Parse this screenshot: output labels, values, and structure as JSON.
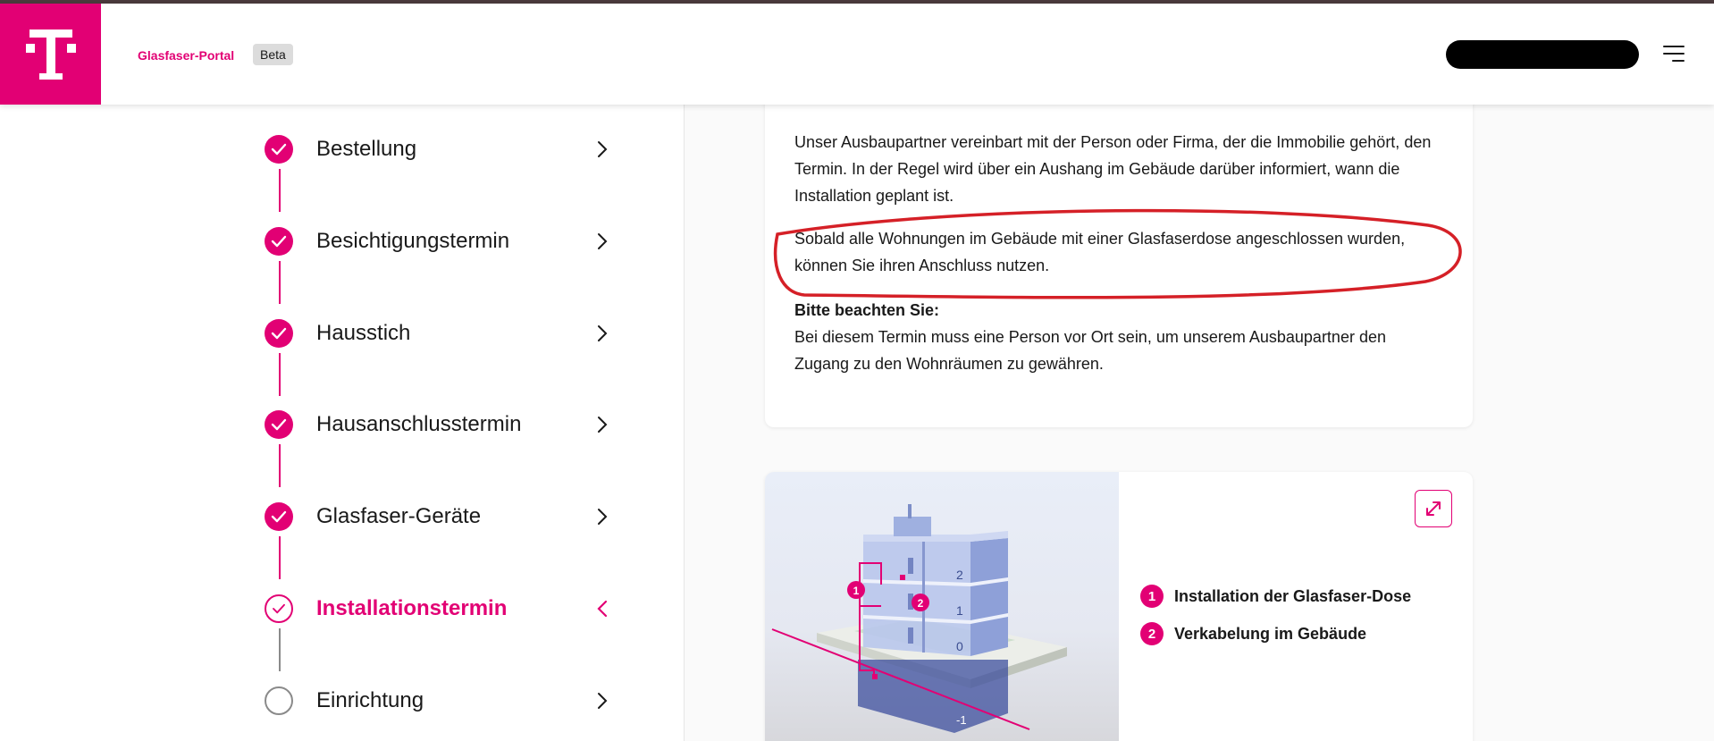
{
  "header": {
    "brand": "Glasfaser-Portal",
    "badge": "Beta",
    "logo_letter": "T",
    "accent": "#e20074",
    "menu_icon": "hamburger-menu-icon"
  },
  "steps": [
    {
      "label": "Bestellung",
      "status": "done"
    },
    {
      "label": "Besichtigungstermin",
      "status": "done"
    },
    {
      "label": "Hausstich",
      "status": "done"
    },
    {
      "label": "Hausanschlusstermin",
      "status": "done"
    },
    {
      "label": "Glasfaser-Geräte",
      "status": "done"
    },
    {
      "label": "Installationstermin",
      "status": "active"
    },
    {
      "label": "Einrichtung",
      "status": "todo"
    }
  ],
  "content": {
    "paragraph1": "Unser Ausbaupartner vereinbart mit der Person oder Firma, der die Immobilie gehört, den Termin. In der Regel wird über ein Aushang im Gebäude darüber informiert, wann die Installation geplant ist.",
    "paragraph2": "Sobald alle Wohnungen im Gebäude mit einer Glasfaserdose angeschlossen wurden, können Sie ihren Anschluss nutzen.",
    "note_heading": "Bitte beachten Sie:",
    "note_text": "Bei diesem Termin muss eine Person vor Ort sein, um unserem Ausbaupartner den Zugang zu den Wohnräumen zu gewähren."
  },
  "illustration": {
    "markers": [
      "1",
      "2"
    ],
    "floor_labels": [
      "2",
      "1",
      "0",
      "-1"
    ],
    "legend": [
      {
        "num": "1",
        "text": "Installation der Glasfaser-Dose"
      },
      {
        "num": "2",
        "text": "Verkabelung im Gebäude"
      }
    ]
  }
}
